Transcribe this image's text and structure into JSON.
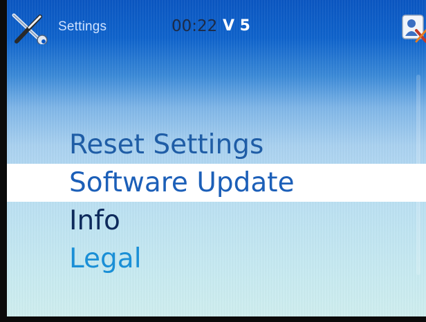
{
  "statusbar": {
    "title": "Settings",
    "time": "00:22",
    "version": "V 5",
    "left_icon": "tools-icon",
    "right_icon": "user-settings-icon"
  },
  "menu": {
    "items": [
      {
        "label": "Reset Settings",
        "state": "normal"
      },
      {
        "label": "Software Update",
        "state": "selected"
      },
      {
        "label": "Info",
        "state": "normal"
      },
      {
        "label": "Legal",
        "state": "normal"
      }
    ]
  },
  "colors": {
    "header_blue": "#0a56c2",
    "selection_bg": "#ffffff",
    "selection_text": "#1c5fb8",
    "item_text_dark": "#0e2a5c",
    "item_text_blue": "#1f5da6",
    "item_text_accent": "#1a8fd6"
  }
}
